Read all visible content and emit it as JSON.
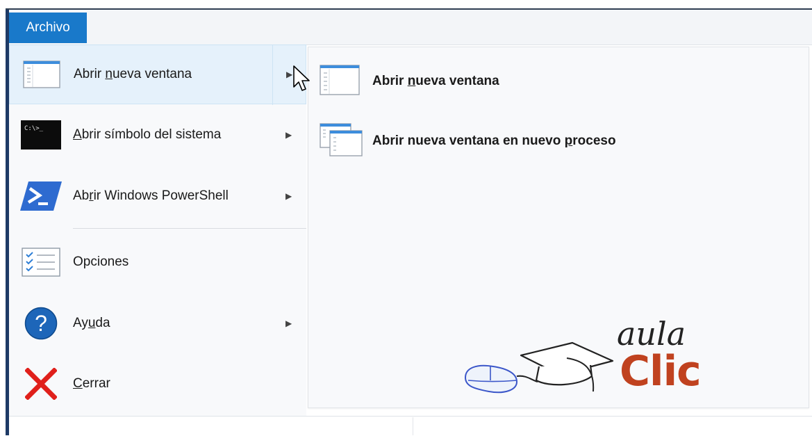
{
  "ribbon": {
    "file_tab_label": "Archivo"
  },
  "file_menu": {
    "items": [
      {
        "label_pre": "Abrir ",
        "accel": "n",
        "label_post": "ueva ventana",
        "icon": "new-window-icon",
        "has_submenu": true
      },
      {
        "label_pre": "",
        "accel": "A",
        "label_post": "brir símbolo del sistema",
        "icon": "command-prompt-icon",
        "has_submenu": true
      },
      {
        "label_pre": "Ab",
        "accel": "r",
        "label_post": "ir Windows PowerShell",
        "icon": "powershell-icon",
        "has_submenu": true
      },
      {
        "label_pre": "",
        "accel": "O",
        "label_post": "pciones",
        "icon": "options-icon",
        "has_submenu": false
      },
      {
        "label_pre": "Ay",
        "accel": "u",
        "label_post": "da",
        "icon": "help-icon",
        "has_submenu": true
      },
      {
        "label_pre": "",
        "accel": "C",
        "label_post": "errar",
        "icon": "close-icon",
        "has_submenu": false
      }
    ],
    "cmd_icon_text": "C:\\>_"
  },
  "submenu": {
    "items": [
      {
        "label_pre": "Abrir ",
        "accel": "n",
        "label_post": "ueva ventana",
        "icon": "new-window-icon"
      },
      {
        "label_pre": "Abrir nueva ventana en nuevo ",
        "accel": "p",
        "label_post": "roceso",
        "icon": "new-process-window-icon"
      }
    ]
  },
  "watermark": {
    "brand_top": "aula",
    "brand_bottom": "Clic"
  },
  "colors": {
    "file_tab": "#1979ca",
    "selected_item_bg": "#e5f1fb",
    "close_red": "#e0201b",
    "help_blue": "#1d66b9",
    "powershell_blue": "#2e6bd0",
    "brand_red": "#c0421f"
  }
}
